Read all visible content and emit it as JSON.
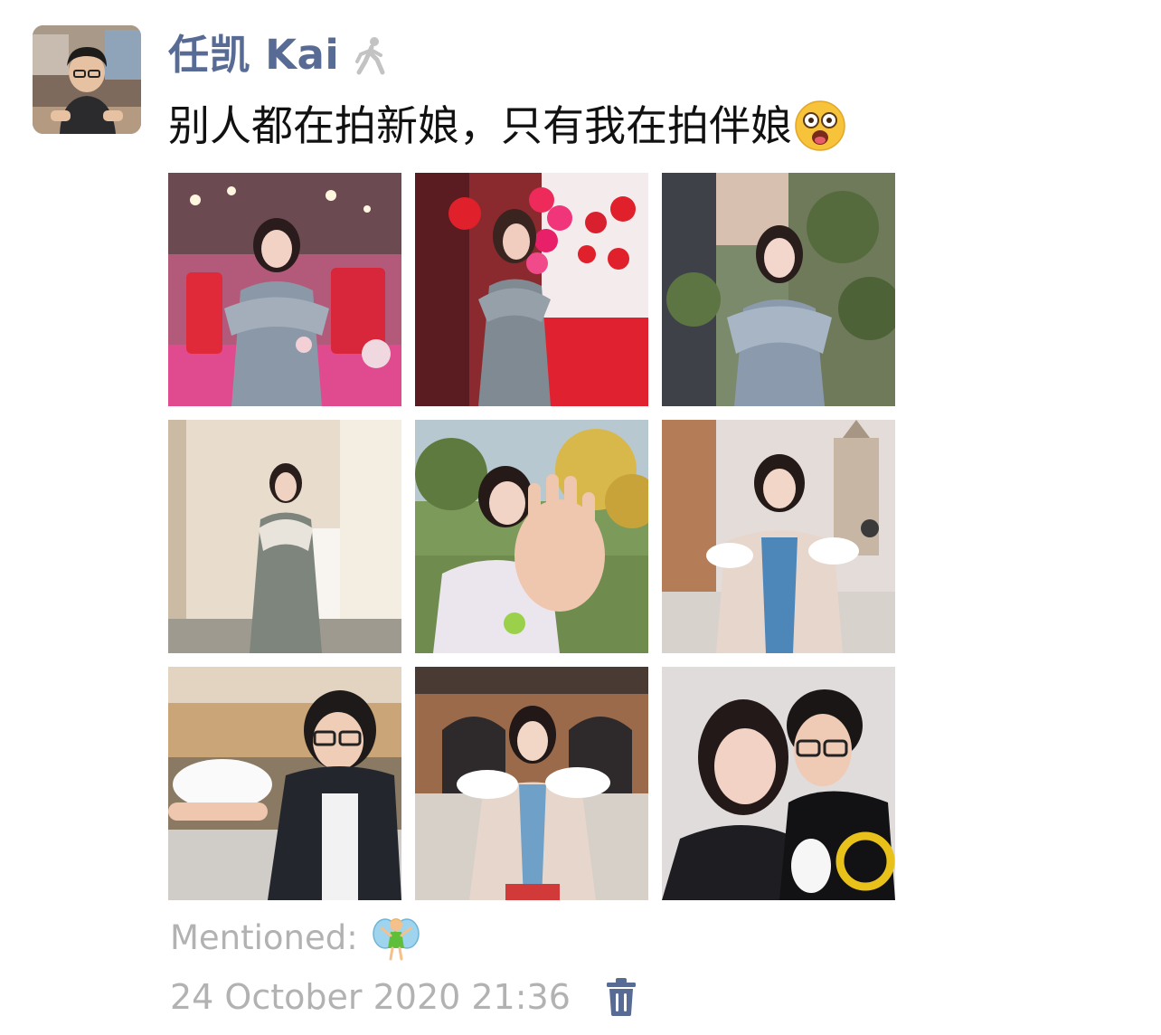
{
  "post": {
    "author": "任凯 Kai",
    "text": "别人都在拍新娘，只有我在拍伴娘",
    "avatar_icon": "avatar-photo",
    "status_icon": "walking-person-icon",
    "emoji_icon": "hushed-face-emoji",
    "photos": [
      {
        "name": "photo-1",
        "scene": "banquet-hall"
      },
      {
        "name": "photo-2",
        "scene": "red-wedding-room"
      },
      {
        "name": "photo-3",
        "scene": "garden-wall"
      },
      {
        "name": "photo-4",
        "scene": "dressing-room"
      },
      {
        "name": "photo-5",
        "scene": "park-hand-wave"
      },
      {
        "name": "photo-6",
        "scene": "church-square-doves"
      },
      {
        "name": "photo-7",
        "scene": "man-with-dove"
      },
      {
        "name": "photo-8",
        "scene": "woman-two-doves"
      },
      {
        "name": "photo-9",
        "scene": "couple-selfie"
      }
    ],
    "mentioned_label": "Mentioned:",
    "mentioned_icon": "fairy-emoji",
    "timestamp": "24 October 2020 21:36",
    "delete_icon": "trash-icon"
  },
  "colors": {
    "name": "#586b95",
    "text": "#111111",
    "meta": "#b2b2b2",
    "link": "#576b95"
  }
}
